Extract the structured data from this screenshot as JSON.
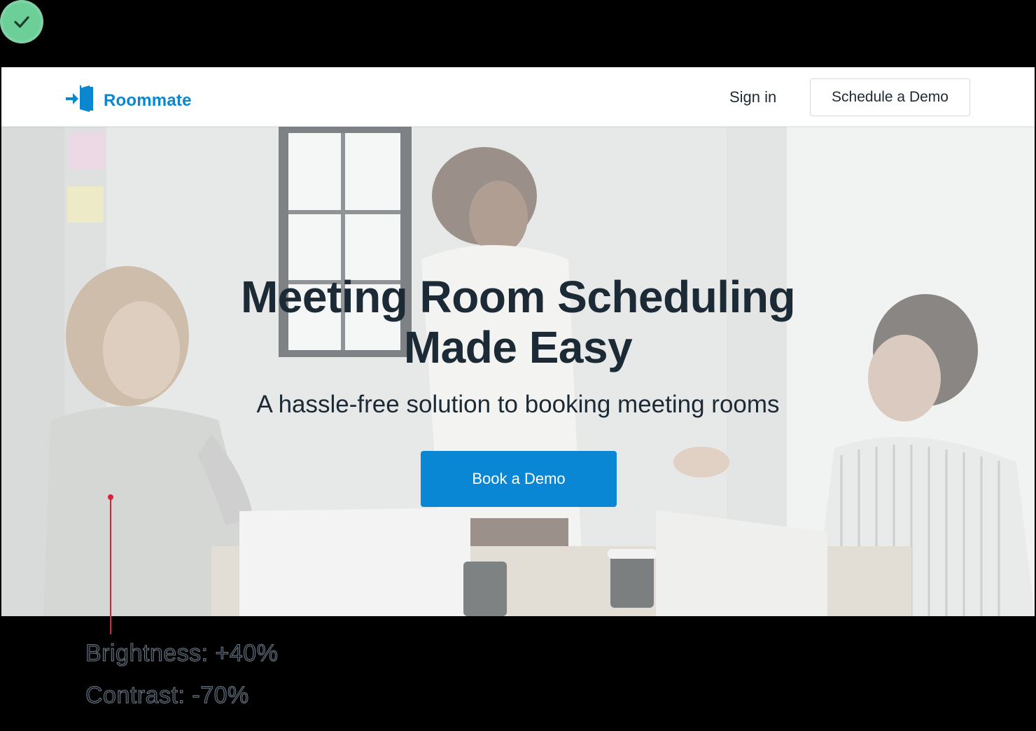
{
  "status_icon": "check-icon",
  "nav": {
    "brand_name": "Roommate",
    "brand_icon": "door-enter-icon",
    "signin_label": "Sign in",
    "schedule_demo_label": "Schedule a Demo"
  },
  "hero": {
    "title_line1": "Meeting Room Scheduling",
    "title_line2": "Made Easy",
    "subtitle": "A hassle-free solution to booking meeting rooms",
    "cta_label": "Book a Demo"
  },
  "annotation": {
    "brightness": "Brightness: +40%",
    "contrast": "Contrast: -70%"
  },
  "colors": {
    "brand": "#0a87cf",
    "cta": "#0a87d4",
    "heading": "#1c2a35",
    "badge": "#6ccf98",
    "annotation_line": "#d9213a"
  }
}
